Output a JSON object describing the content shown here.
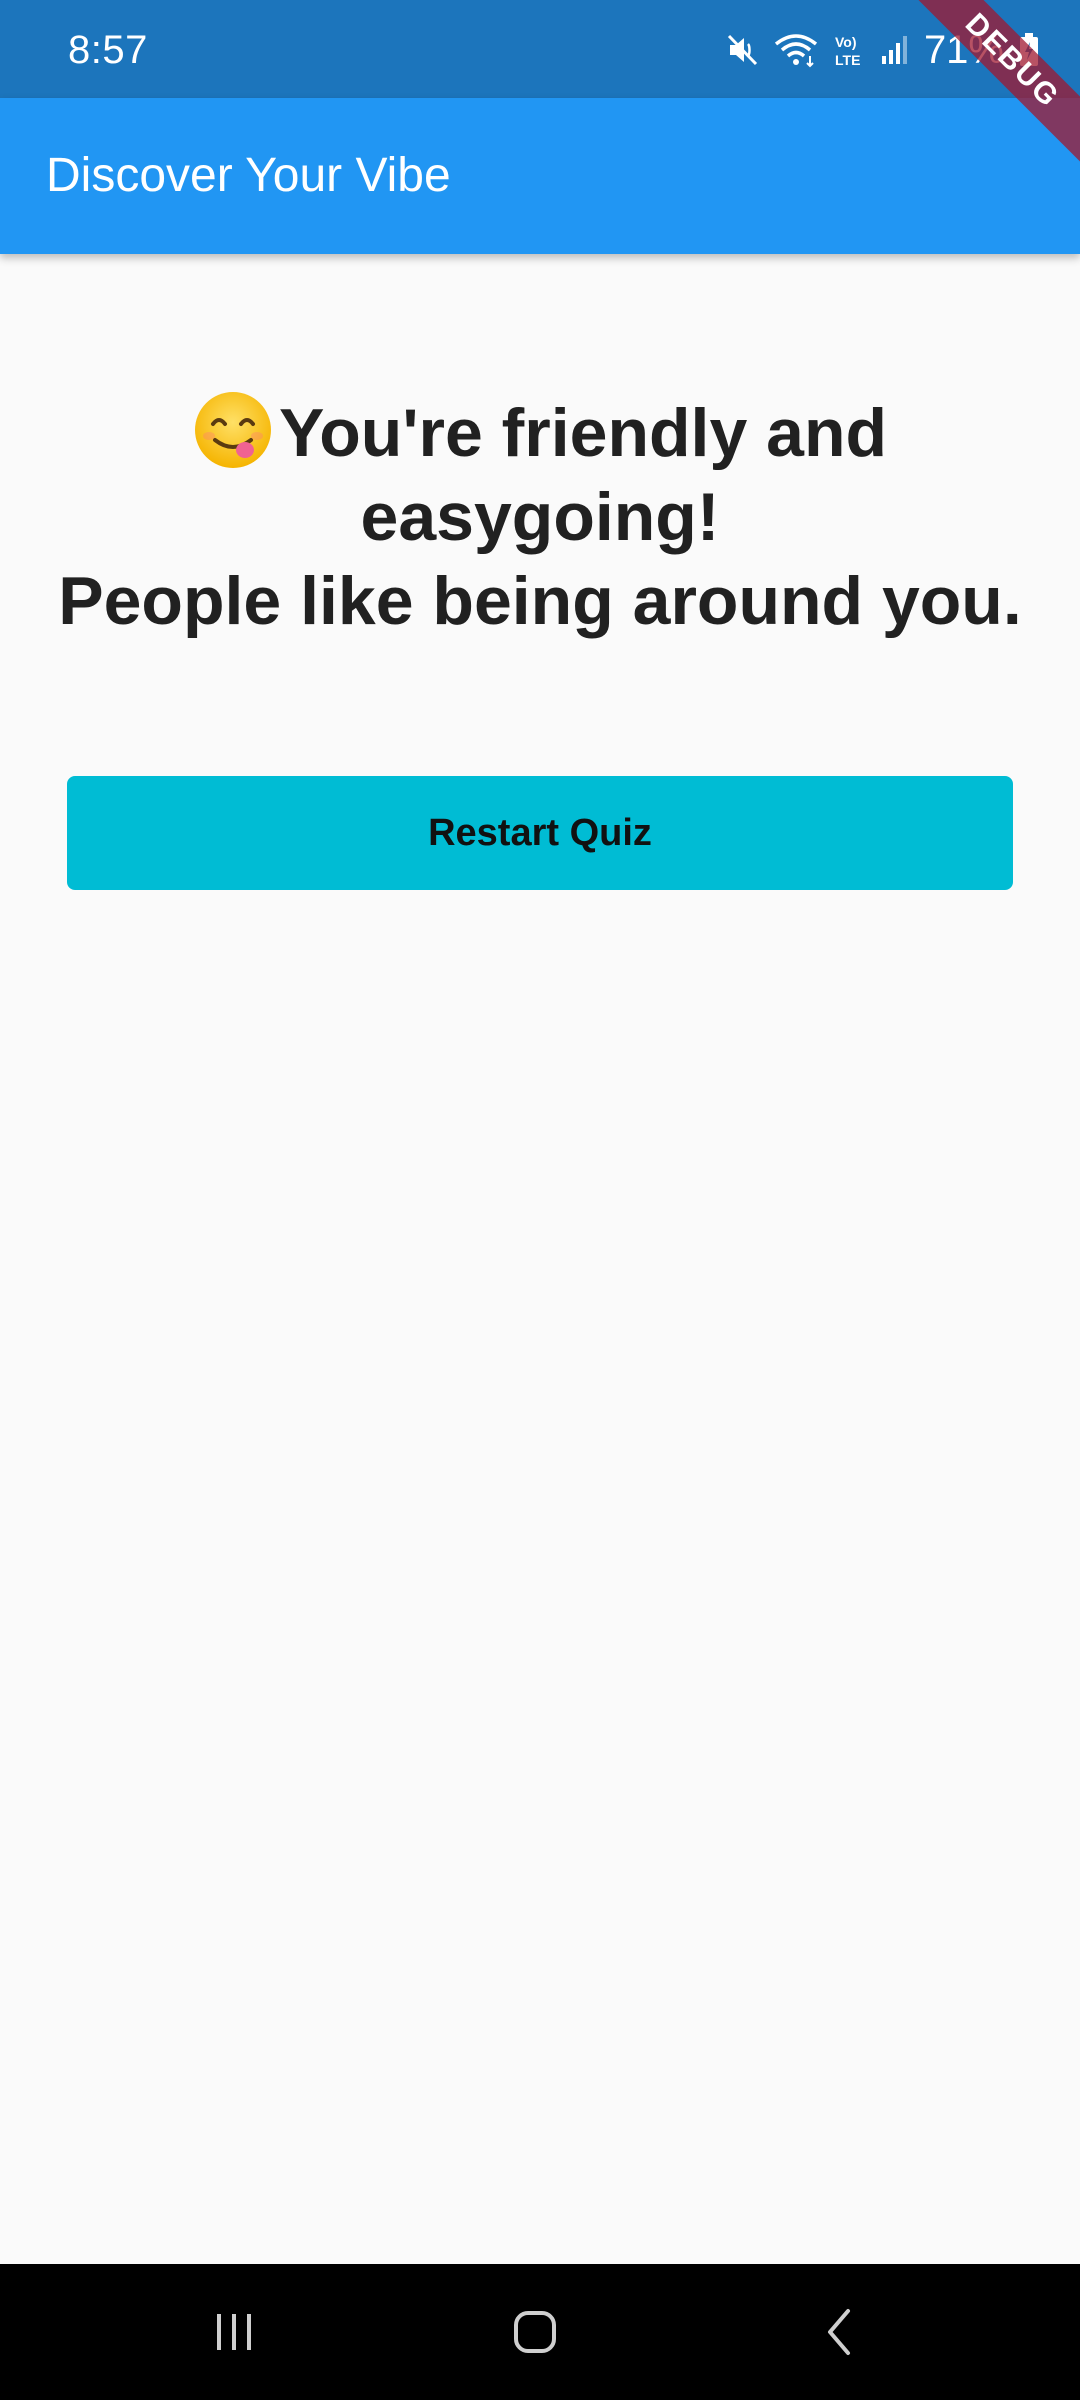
{
  "status_bar": {
    "time": "8:57",
    "battery": "71%",
    "icons": [
      "mute-icon",
      "wifi-icon",
      "volte-icon",
      "signal-icon",
      "battery-icon"
    ]
  },
  "debug_banner": {
    "label": "DEBUG"
  },
  "app_bar": {
    "title": "Discover Your Vibe"
  },
  "result": {
    "emoji_icon": "face-savoring-food-icon",
    "line1": "You're friendly and easygoing!",
    "line2": "People like being around you."
  },
  "restart_button": {
    "label": "Restart Quiz"
  },
  "colors": {
    "status_bar": "#1c75bc",
    "app_bar": "#2196f3",
    "button": "#00bcd4",
    "background": "#fafafa"
  },
  "nav_bar": {
    "buttons": [
      "recents-icon",
      "home-icon",
      "back-icon"
    ]
  }
}
